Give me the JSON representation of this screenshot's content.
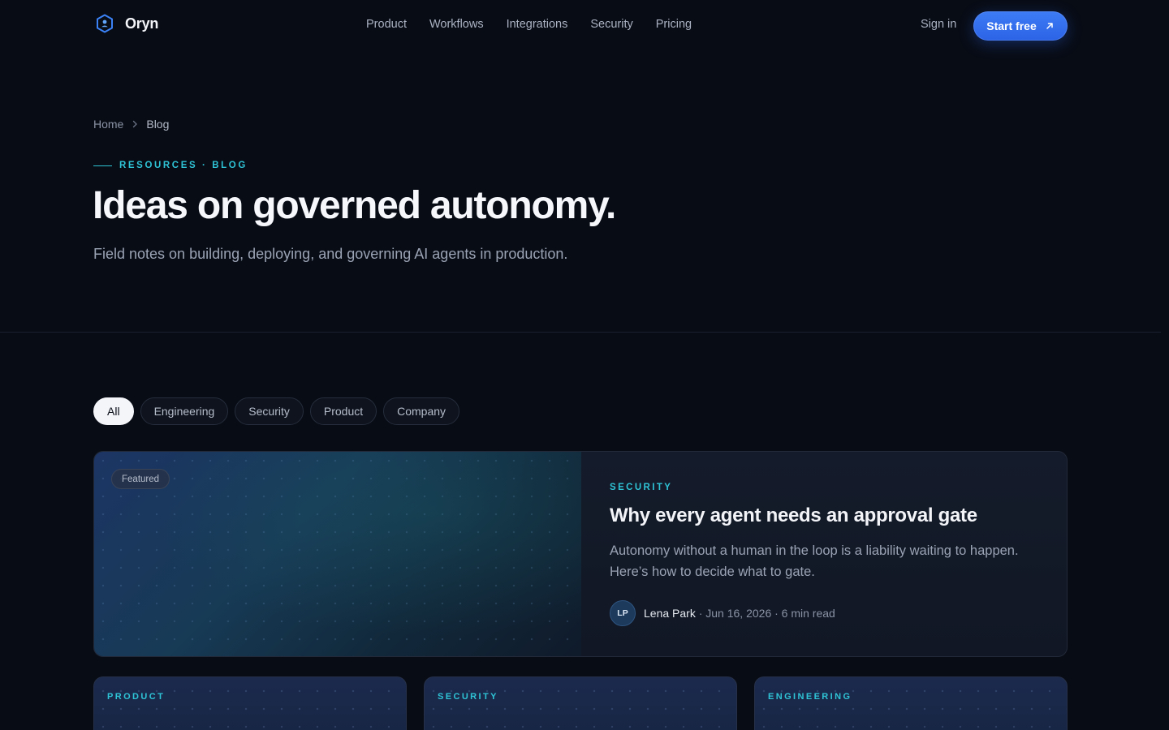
{
  "brand": {
    "name": "Oryn",
    "logo_icon": "hexagon-logo-icon"
  },
  "nav": {
    "items": [
      "Product",
      "Workflows",
      "Integrations",
      "Security",
      "Pricing"
    ],
    "sign_in": "Sign in",
    "cta": "Start free",
    "cta_icon": "arrow-up-right-icon"
  },
  "breadcrumb": {
    "items": [
      "Home",
      "Blog"
    ],
    "separator_icon": "chevron-right-icon"
  },
  "hero": {
    "eyebrow": "RESOURCES · BLOG",
    "title": "Ideas on governed autonomy.",
    "subtitle": "Field notes on building, deploying, and governing AI agents in production."
  },
  "filters": {
    "items": [
      "All",
      "Engineering",
      "Security",
      "Product",
      "Company"
    ],
    "active": "All"
  },
  "featured": {
    "badge": "Featured",
    "category": "SECURITY",
    "title": "Why every agent needs an approval gate",
    "excerpt": "Autonomy without a human in the loop is a liability waiting to happen. Here’s how to decide what to gate.",
    "author_initials": "LP",
    "author": "Lena Park",
    "meta": " · Jun 16, 2026 · 6 min read"
  },
  "cards": [
    {
      "category": "PRODUCT"
    },
    {
      "category": "SECURITY"
    },
    {
      "category": "ENGINEERING"
    }
  ],
  "colors": {
    "accent": "#2fc3d6",
    "primary": "#2c63e6",
    "background": "#080c15"
  }
}
